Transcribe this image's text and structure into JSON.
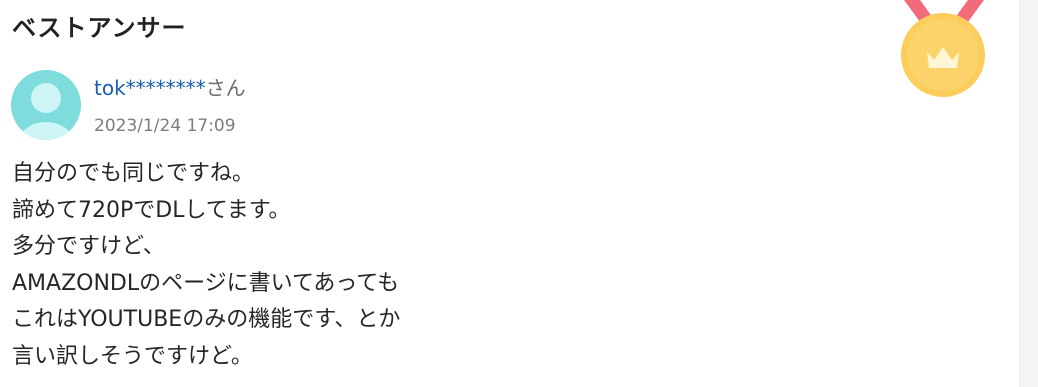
{
  "section": {
    "title": "ベストアンサー"
  },
  "icons": {
    "medal": "crown-medal-icon",
    "avatar": "default-user-avatar-icon"
  },
  "colors": {
    "username_link": "#1a5cae",
    "date_text": "#7d7d7d",
    "body_text": "#262626",
    "medal_gold": "#fbce5b",
    "medal_ribbon": "#f26b7a",
    "avatar_teal": "#7fdcdc"
  },
  "answer": {
    "user": {
      "name": "tok********",
      "suffix": "さん"
    },
    "date": "2023/1/24 17:09",
    "lines": [
      "自分のでも同じですね。",
      "諦めて720PでDLしてます。",
      "多分ですけど、",
      "AMAZONDLのページに書いてあっても",
      "これはYOUTUBEのみの機能です、とか",
      "言い訳しそうですけど。"
    ]
  }
}
